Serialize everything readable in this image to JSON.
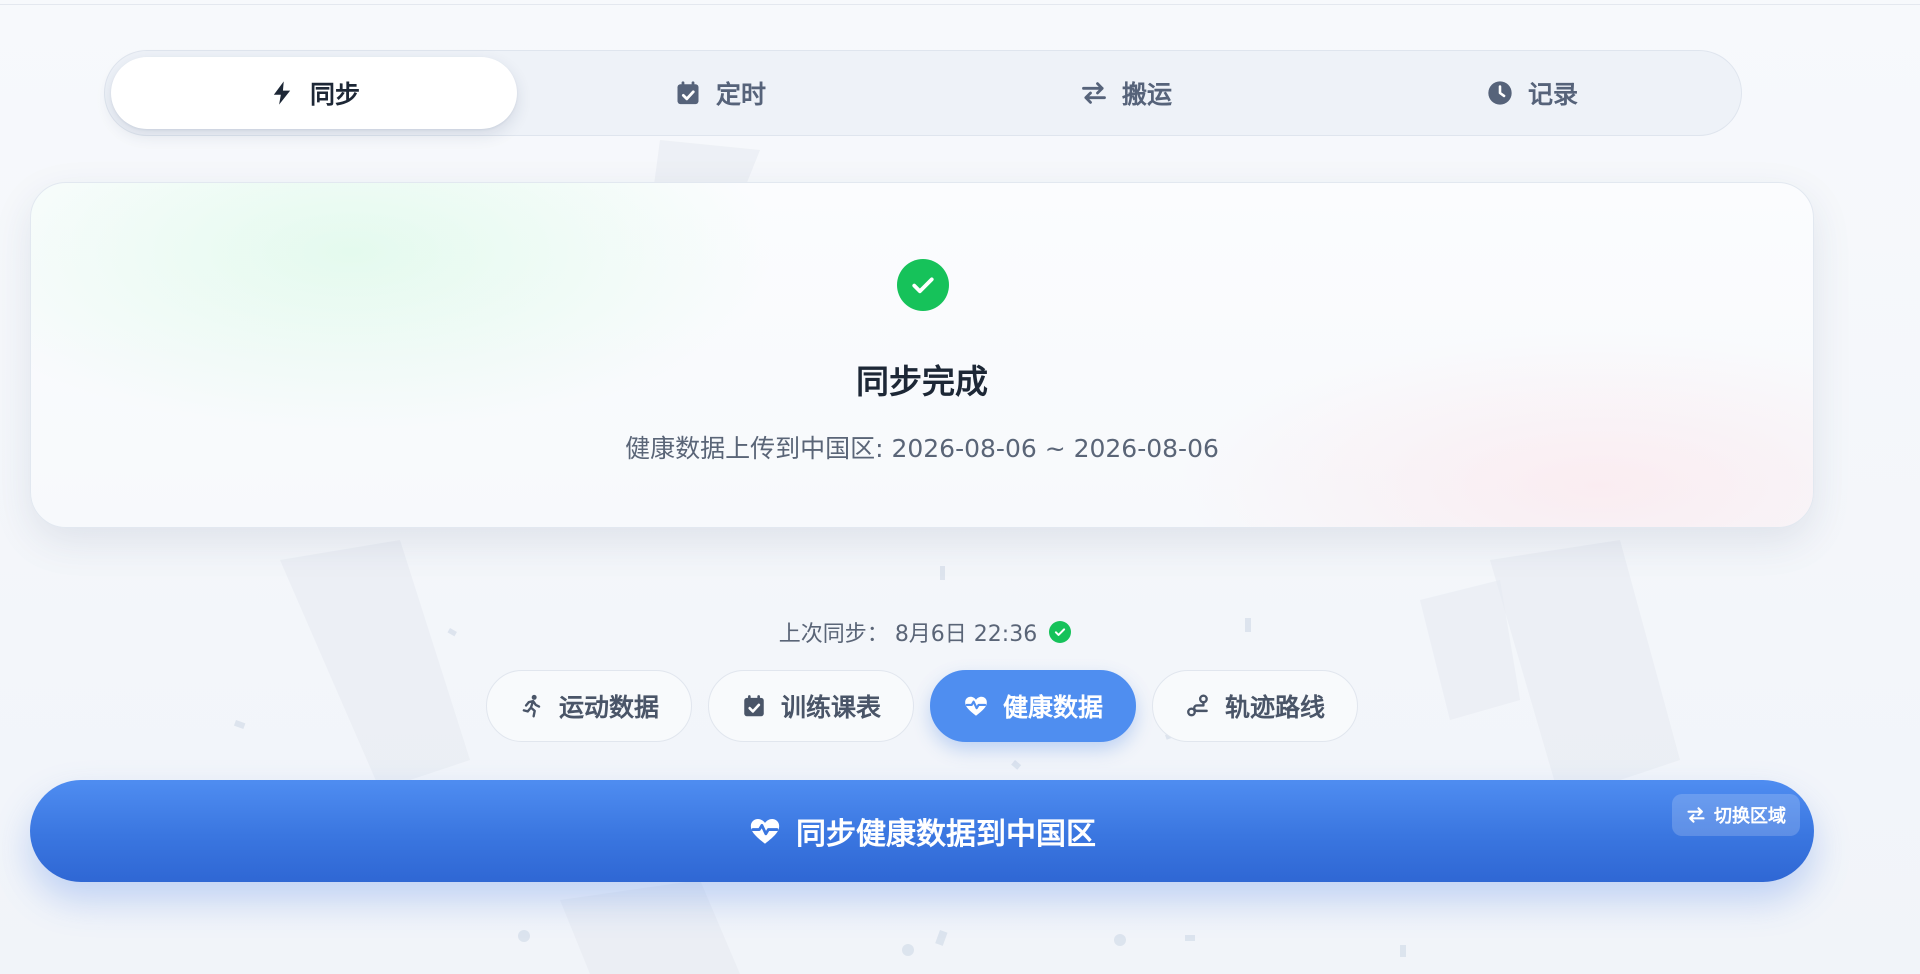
{
  "tabs": [
    {
      "label": "同步",
      "icon": "bolt-icon",
      "active": true
    },
    {
      "label": "定时",
      "icon": "calendar-check-icon",
      "active": false
    },
    {
      "label": "搬运",
      "icon": "swap-arrows-icon",
      "active": false
    },
    {
      "label": "记录",
      "icon": "clock-icon",
      "active": false
    }
  ],
  "status": {
    "icon": "check-circle-icon",
    "title": "同步完成",
    "description": "健康数据上传到中国区: 2026-08-06 ~ 2026-08-06"
  },
  "last_sync": {
    "label": "上次同步：",
    "value": "8月6日 22:36",
    "status_icon": "check-circle-icon"
  },
  "data_types": [
    {
      "label": "运动数据",
      "icon": "running-icon",
      "active": false
    },
    {
      "label": "训练课表",
      "icon": "calendar-check-icon",
      "active": false
    },
    {
      "label": "健康数据",
      "icon": "heartbeat-icon",
      "active": true
    },
    {
      "label": "轨迹路线",
      "icon": "route-icon",
      "active": false
    }
  ],
  "primary_action": {
    "label": "同步健康数据到中国区",
    "icon": "heartbeat-icon",
    "switch_label": "切换区域",
    "switch_icon": "swap-arrows-icon"
  },
  "colors": {
    "accent": "#3a76e0",
    "success": "#16c25a",
    "text_primary": "#1d2736",
    "text_secondary": "#5a6577"
  }
}
